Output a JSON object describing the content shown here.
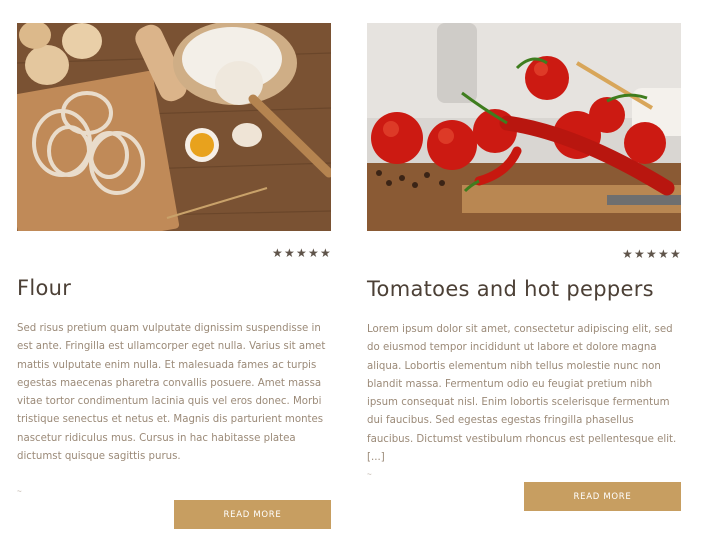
{
  "cards": [
    {
      "title": "Flour",
      "rating": 5,
      "excerpt": "Sed risus pretium quam vulputate dignissim suspendisse in est ante. Fringilla est ullamcorper eget nulla. Varius sit amet mattis vulputate enim nulla. Et malesuada fames ac turpis egestas maecenas pharetra convallis posuere. Amet massa vitae tortor condimentum lacinia quis vel eros donec. Morbi tristique senectus et netus et. Magnis dis parturient montes nascetur ridiculus mus. Cursus in hac habitasse platea dictumst quisque sagittis purus.",
      "meta": "~",
      "button_label": "READ MORE"
    },
    {
      "title": "Tomatoes and hot peppers",
      "rating": 5,
      "excerpt": "Lorem ipsum dolor sit amet, consectetur adipiscing elit, sed do eiusmod tempor incididunt ut labore et dolore magna aliqua. Lobortis elementum nibh tellus molestie nunc non blandit massa. Fermentum odio eu feugiat pretium nibh ipsum consequat nisl. Enim lobortis scelerisque fermentum dui faucibus. Sed egestas egestas fringilla phasellus faucibus. Dictumst vestibulum rhoncus est pellentesque elit. [...]",
      "meta": "~",
      "button_label": "READ MORE"
    }
  ],
  "colors": {
    "accent": "#c79e61",
    "title": "#4c4036",
    "text": "#9b8a78",
    "star": "#5f544a"
  }
}
